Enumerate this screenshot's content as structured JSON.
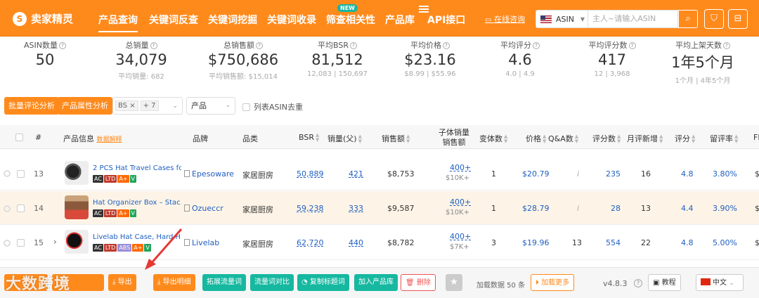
{
  "brand": {
    "name": "卖家精灵",
    "logo_glyph": "S"
  },
  "nav": {
    "items": [
      "产品查询",
      "关键词反查",
      "关键词挖掘",
      "关键词收录",
      "筛查相关性",
      "产品库",
      "API接口"
    ],
    "new_badge": "NEW",
    "consult": "在线咨询"
  },
  "search": {
    "marketplace": "ASIN",
    "placeholder": "主人~请输入ASIN"
  },
  "stats": [
    {
      "label": "ASIN数量",
      "value": "50",
      "sub": ""
    },
    {
      "label": "总销量",
      "value": "34,079",
      "sub": "平均销量: 682"
    },
    {
      "label": "总销售额",
      "value": "$750,686",
      "sub": "平均销售额: $15,014"
    },
    {
      "label": "平均BSR",
      "value": "81,512",
      "sub": "12,083 | 150,697"
    },
    {
      "label": "平均价格",
      "value": "$23.16",
      "sub": "$8.99 | $55.96"
    },
    {
      "label": "平均评分",
      "value": "4.6",
      "sub": "4.0 | 4.9"
    },
    {
      "label": "平均评分数",
      "value": "417",
      "sub": "12 | 3,968"
    },
    {
      "label": "平均上架天数",
      "value": "1年5个月",
      "sub": "1个月 | 4年5个月"
    }
  ],
  "filters": {
    "batch_review": "批量评论分析",
    "attr_analysis": "产品属性分析",
    "tag": "BS",
    "tag_more": "+ 7",
    "select_value": "产品",
    "dedup_label": "列表ASIN去重"
  },
  "table": {
    "headers": {
      "num": "#",
      "info": "产品信息",
      "info_link": "数据解释",
      "brand": "品牌",
      "category": "品类",
      "bsr": "BSR",
      "sales": "销量(父)",
      "revenue": "销售额",
      "child_sales_1": "子体销量",
      "child_sales_2": "销售额",
      "variants": "变体数",
      "price": "价格",
      "qa": "Q&A数",
      "ratings": "评分数",
      "monthly_new": "月评新增",
      "rating": "评分",
      "retention": "留评率",
      "fba": "FE"
    },
    "rows": [
      {
        "num": "13",
        "title": "2 PCS Hat Travel Cases fo...",
        "brand": "Epesoware",
        "category": "家居厨房",
        "bsr": "50,889",
        "sales": "421",
        "revenue": "$8,753",
        "child_sales": "400+",
        "child_revenue": "$10K+",
        "variants": "1",
        "price": "$20.79",
        "qa": "i",
        "ratings": "235",
        "monthly_new": "16",
        "rating": "4.8",
        "retention": "3.80%",
        "badges": [
          "AC",
          "LTD",
          "A+",
          "V"
        ],
        "fba": "$"
      },
      {
        "num": "14",
        "title": "Hat Organizer Box – Stac...",
        "brand": "Ozueccr",
        "category": "家居厨房",
        "bsr": "59,238",
        "sales": "333",
        "revenue": "$9,587",
        "child_sales": "400+",
        "child_revenue": "$10K+",
        "variants": "1",
        "price": "$28.79",
        "qa": "i",
        "ratings": "28",
        "monthly_new": "13",
        "rating": "4.4",
        "retention": "3.90%",
        "badges": [
          "AC",
          "LTD",
          "A+",
          "V"
        ],
        "fba": "$"
      },
      {
        "num": "15",
        "title": "Livelab Hat Case, Hard H...",
        "brand": "Livelab",
        "category": "家居厨房",
        "bsr": "62,720",
        "sales": "440",
        "revenue": "$8,782",
        "child_sales": "400+",
        "child_revenue": "$7K+",
        "variants": "3",
        "price": "$19.96",
        "qa": "13",
        "ratings": "554",
        "monthly_new": "22",
        "rating": "4.8",
        "retention": "5.00%",
        "badges": [
          "AC",
          "LTD",
          "ABS",
          "A+",
          "V"
        ],
        "fba": "$"
      }
    ]
  },
  "bottom": {
    "export": "导出",
    "export_detail": "导出明细",
    "expand": "拓展流量词",
    "compare": "流量词对比",
    "copy_title": "复制标题词",
    "add_lib": "加入产品库",
    "delete": "删除",
    "loaded": "加载数据 50 条",
    "load_more": "加载更多",
    "version": "v4.8.3",
    "tutorial": "教程",
    "lang": "中文"
  },
  "watermark": "大数跨境",
  "colors": {
    "accent": "#ff8a1c",
    "teal": "#16b8a0",
    "link": "#1f5fc0",
    "highlight_row": "#fdf4e7"
  }
}
